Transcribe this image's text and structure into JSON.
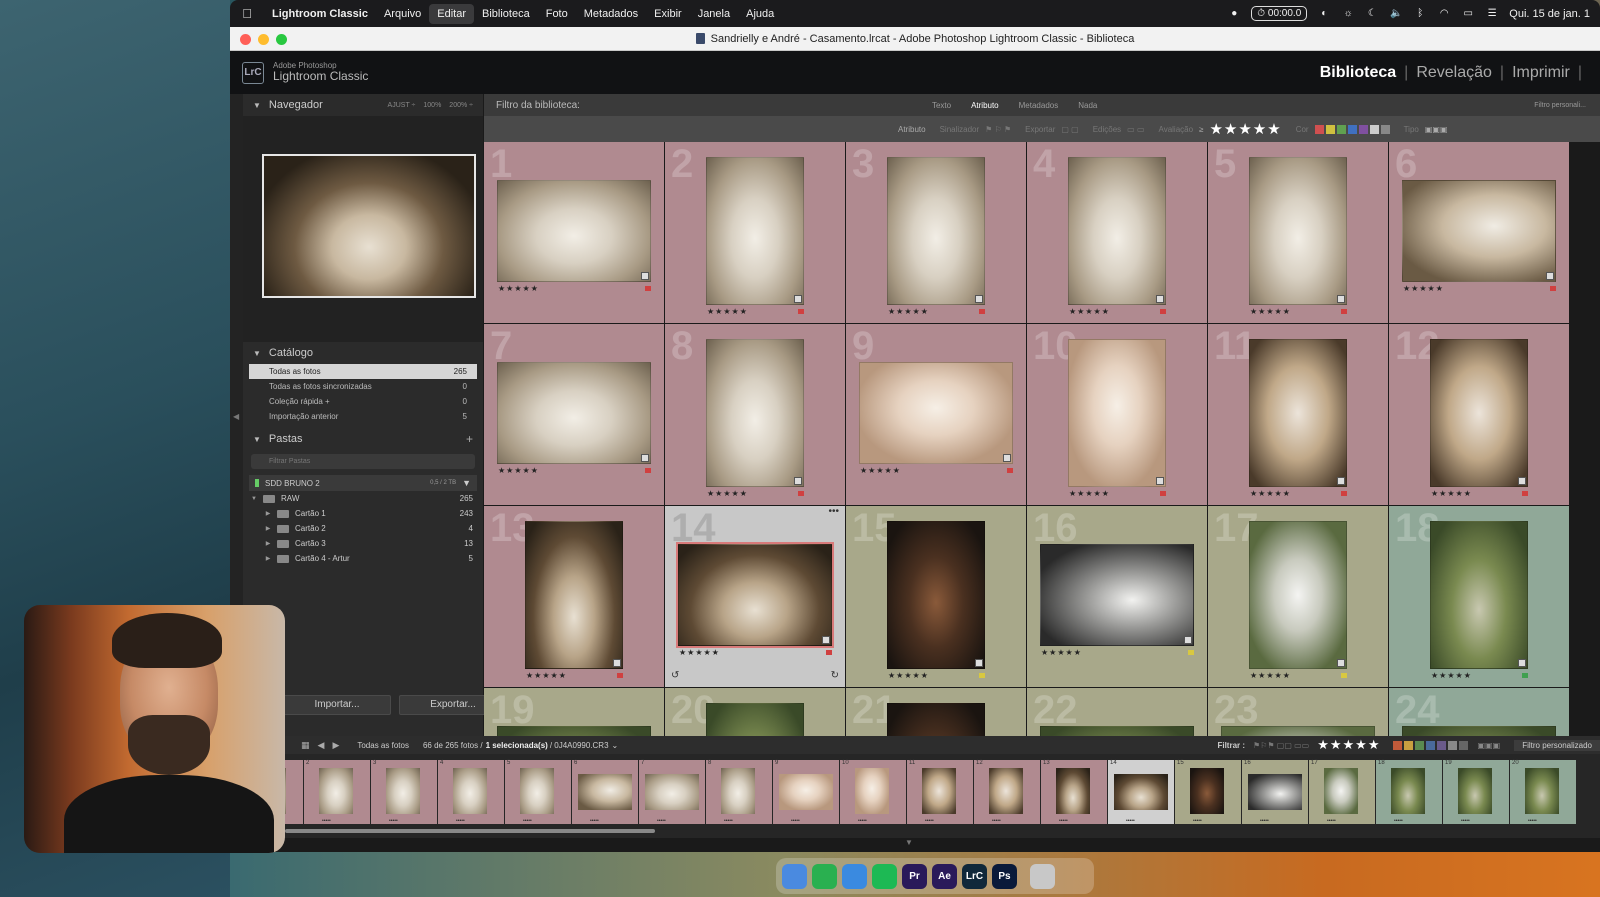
{
  "menubar": {
    "app": "Lightroom Classic",
    "items": [
      "Arquivo",
      "Editar",
      "Biblioteca",
      "Foto",
      "Metadados",
      "Exibir",
      "Janela",
      "Ajuda"
    ],
    "active_index": 1,
    "timer": "00:00.0",
    "datetime": "Qui. 15 de jan. 1"
  },
  "window": {
    "title": "Sandrielly e André - Casamento.lrcat - Adobe Photoshop Lightroom Classic - Biblioteca"
  },
  "lr_header": {
    "logo": "LrC",
    "brand_top": "Adobe Photoshop",
    "brand_bottom": "Lightroom Classic",
    "modules": [
      "Biblioteca",
      "Revelação",
      "Imprimir"
    ],
    "active_module": "Biblioteca"
  },
  "navigator": {
    "title": "Navegador",
    "options": [
      "AJUST ÷",
      "100%",
      "200% ÷"
    ]
  },
  "catalog": {
    "title": "Catálogo",
    "items": [
      {
        "label": "Todas as fotos",
        "count": "265",
        "selected": true
      },
      {
        "label": "Todas as fotos sincronizadas",
        "count": "0"
      },
      {
        "label": "Coleção rápida +",
        "count": "0"
      },
      {
        "label": "Importação anterior",
        "count": "5"
      }
    ]
  },
  "folders": {
    "title": "Pastas",
    "search_placeholder": "Filtrar Pastas",
    "volume": {
      "name": "SDD BRUNO 2",
      "size": "0,5 / 2 TB"
    },
    "items": [
      {
        "label": "RAW",
        "count": "265",
        "level": 0
      },
      {
        "label": "Cartão 1",
        "count": "243",
        "level": 1
      },
      {
        "label": "Cartão 2",
        "count": "4",
        "level": 1
      },
      {
        "label": "Cartão 3",
        "count": "13",
        "level": 1
      },
      {
        "label": "Cartão 4 - Artur",
        "count": "5",
        "level": 1
      }
    ]
  },
  "buttons": {
    "import": "Importar...",
    "export": "Exportar..."
  },
  "filter_bar": {
    "label": "Filtro da biblioteca:",
    "tabs": [
      "Texto",
      "Atributo",
      "Metadados",
      "Nada"
    ],
    "active_tab": "Atributo",
    "preset": "Filtro personali..."
  },
  "attribute_bar": {
    "attribute": "Atributo",
    "flag": "Sinalizador",
    "export": "Exportar",
    "edits": "Edições",
    "rating": "Avaliação",
    "rating_op": "≥",
    "color": "Cor",
    "type": "Tipo",
    "stars": "★★★★★",
    "colors": [
      "#d05050",
      "#d0c040",
      "#60a050",
      "#4070c0",
      "#8050a0",
      "#cccccc",
      "#888888"
    ]
  },
  "grid": {
    "cells": [
      {
        "n": "1",
        "bg": "#b08a90",
        "orient": "land",
        "tone": "a",
        "stars": "★★★★★",
        "flag": "#d04040"
      },
      {
        "n": "2",
        "bg": "#b08a90",
        "orient": "port",
        "tone": "a",
        "stars": "★★★★★",
        "flag": "#d04040"
      },
      {
        "n": "3",
        "bg": "#b08a90",
        "orient": "port",
        "tone": "a",
        "stars": "★★★★★",
        "flag": "#d04040"
      },
      {
        "n": "4",
        "bg": "#b08a90",
        "orient": "port",
        "tone": "a",
        "stars": "★★★★★",
        "flag": "#d04040"
      },
      {
        "n": "5",
        "bg": "#b08a90",
        "orient": "port",
        "tone": "a",
        "stars": "★★★★★",
        "flag": "#d04040"
      },
      {
        "n": "6",
        "bg": "#b08a90",
        "orient": "land",
        "tone": "b",
        "stars": "★★★★★",
        "flag": "#d04040"
      },
      {
        "n": "7",
        "bg": "#b08a90",
        "orient": "land",
        "tone": "a",
        "stars": "★★★★★",
        "flag": "#d04040"
      },
      {
        "n": "8",
        "bg": "#b08a90",
        "orient": "port",
        "tone": "a",
        "stars": "★★★★★",
        "flag": "#d04040"
      },
      {
        "n": "9",
        "bg": "#b08a90",
        "orient": "land",
        "tone": "c",
        "stars": "★★★★★",
        "flag": "#d04040"
      },
      {
        "n": "10",
        "bg": "#b08a90",
        "orient": "port",
        "tone": "c",
        "stars": "★★★★★",
        "flag": "#d04040"
      },
      {
        "n": "11",
        "bg": "#b08a90",
        "orient": "port",
        "tone": "d",
        "stars": "★★★★★",
        "flag": "#d04040"
      },
      {
        "n": "12",
        "bg": "#b08a90",
        "orient": "port",
        "tone": "d",
        "stars": "★★★★★",
        "flag": "#d04040"
      },
      {
        "n": "13",
        "bg": "#b08a90",
        "orient": "port",
        "tone": "e",
        "stars": "★★★★★",
        "flag": "#d04040"
      },
      {
        "n": "14",
        "bg": "#c8c8c8",
        "orient": "land",
        "tone": "e",
        "stars": "★★★★★",
        "flag": "#d04040",
        "selected": true
      },
      {
        "n": "15",
        "bg": "#a8a88a",
        "orient": "port",
        "tone": "f",
        "stars": "★★★★★",
        "flag": "#d8c840"
      },
      {
        "n": "16",
        "bg": "#a8a88a",
        "orient": "land",
        "tone": "g",
        "stars": "★★★★★",
        "flag": "#d8c840"
      },
      {
        "n": "17",
        "bg": "#a8a88a",
        "orient": "port",
        "tone": "h",
        "stars": "★★★★★",
        "flag": "#d8c840"
      },
      {
        "n": "18",
        "bg": "#90a898",
        "orient": "port",
        "tone": "i",
        "stars": "★★★★★",
        "flag": "#40a050"
      },
      {
        "n": "19",
        "bg": "#a8a88a",
        "orient": "land",
        "tone": "i",
        "stars": "",
        "flag": ""
      },
      {
        "n": "20",
        "bg": "#a8a88a",
        "orient": "port",
        "tone": "i",
        "stars": "",
        "flag": ""
      },
      {
        "n": "21",
        "bg": "#a8a88a",
        "orient": "port",
        "tone": "f",
        "stars": "",
        "flag": ""
      },
      {
        "n": "22",
        "bg": "#a8a88a",
        "orient": "land",
        "tone": "i",
        "stars": "",
        "flag": ""
      },
      {
        "n": "23",
        "bg": "#a8a88a",
        "orient": "land",
        "tone": "h",
        "stars": "",
        "flag": ""
      },
      {
        "n": "24",
        "bg": "#90a898",
        "orient": "land",
        "tone": "i",
        "stars": "",
        "flag": ""
      }
    ]
  },
  "toolbar": {
    "source": "Todas as fotos",
    "count_prefix": "66 de 265 fotos /",
    "selected": "1 selecionada(s)",
    "file": "/ 0J4A0990.CR3",
    "filter_label": "Filtrar :",
    "stars": "★★★★★",
    "preset": "Filtro personalizado",
    "colors": [
      "#c05a3a",
      "#c8a040",
      "#5a8a50",
      "#4a6a9a",
      "#6a5a8a",
      "#888888",
      "#666666"
    ]
  },
  "filmstrip": {
    "items": [
      {
        "n": "",
        "tone": "a",
        "orient": "port",
        "bg": "#b08a90"
      },
      {
        "n": "2",
        "tone": "a",
        "orient": "port",
        "bg": "#b08a90"
      },
      {
        "n": "3",
        "tone": "a",
        "orient": "port",
        "bg": "#b08a90"
      },
      {
        "n": "4",
        "tone": "a",
        "orient": "port",
        "bg": "#b08a90"
      },
      {
        "n": "5",
        "tone": "a",
        "orient": "port",
        "bg": "#b08a90"
      },
      {
        "n": "6",
        "tone": "b",
        "orient": "land",
        "bg": "#b08a90"
      },
      {
        "n": "7",
        "tone": "a",
        "orient": "land",
        "bg": "#b08a90"
      },
      {
        "n": "8",
        "tone": "a",
        "orient": "port",
        "bg": "#b08a90"
      },
      {
        "n": "9",
        "tone": "c",
        "orient": "land",
        "bg": "#b08a90"
      },
      {
        "n": "10",
        "tone": "c",
        "orient": "port",
        "bg": "#b08a90"
      },
      {
        "n": "11",
        "tone": "d",
        "orient": "port",
        "bg": "#b08a90"
      },
      {
        "n": "12",
        "tone": "d",
        "orient": "port",
        "bg": "#b08a90"
      },
      {
        "n": "13",
        "tone": "e",
        "orient": "port",
        "bg": "#b08a90"
      },
      {
        "n": "14",
        "tone": "e",
        "orient": "land",
        "bg": "#d0d0d0"
      },
      {
        "n": "15",
        "tone": "f",
        "orient": "port",
        "bg": "#a8a88a"
      },
      {
        "n": "16",
        "tone": "g",
        "orient": "land",
        "bg": "#a8a88a"
      },
      {
        "n": "17",
        "tone": "h",
        "orient": "port",
        "bg": "#a8a88a"
      },
      {
        "n": "18",
        "tone": "i",
        "orient": "port",
        "bg": "#90a898"
      },
      {
        "n": "19",
        "tone": "i",
        "orient": "port",
        "bg": "#90a898"
      },
      {
        "n": "20",
        "tone": "i",
        "orient": "port",
        "bg": "#90a898"
      }
    ]
  },
  "dock": {
    "apps": [
      {
        "name": "finder-icon",
        "label": "",
        "color": "#4a8ae0"
      },
      {
        "name": "whatsapp-icon",
        "label": "",
        "color": "#2ab050"
      },
      {
        "name": "safari-icon",
        "label": "",
        "color": "#3a8ae0"
      },
      {
        "name": "spotify-icon",
        "label": "",
        "color": "#1db954"
      },
      {
        "name": "premiere-icon",
        "label": "Pr",
        "color": "#2a1a5a"
      },
      {
        "name": "after-effects-icon",
        "label": "Ae",
        "color": "#2a1a5a"
      },
      {
        "name": "lightroom-classic-icon",
        "label": "LrC",
        "color": "#10283a"
      },
      {
        "name": "photoshop-icon",
        "label": "Ps",
        "color": "#0a1a3a"
      },
      {
        "name": "trash-icon",
        "label": "",
        "color": "#c8c8c8"
      }
    ]
  }
}
